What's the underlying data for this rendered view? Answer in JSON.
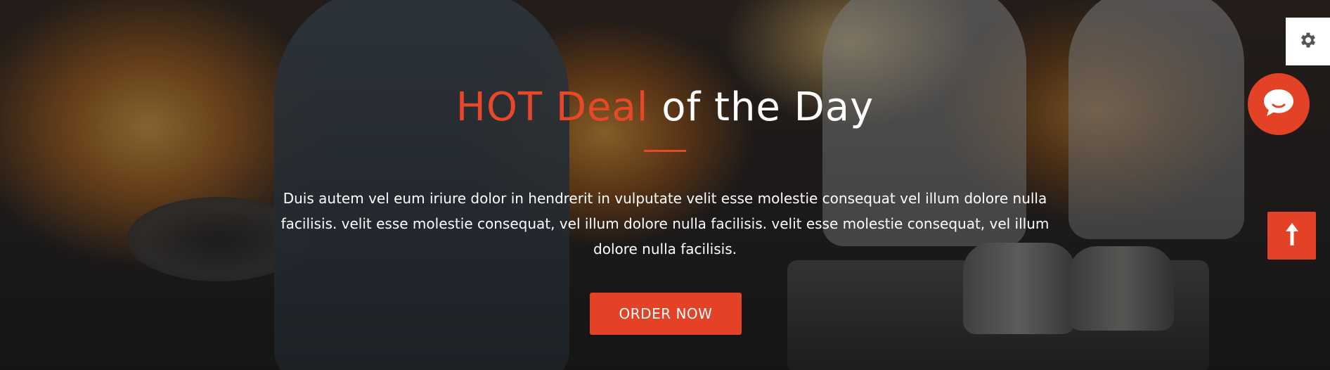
{
  "hero": {
    "title_accent": "HOT Deal",
    "title_rest": "of the Day",
    "description": "Duis autem vel eum iriure dolor in hendrerit in vulputate velit esse molestie consequat vel illum dolore nulla facilisis. velit esse molestie consequat, vel illum dolore nulla facilisis. velit esse molestie consequat, vel illum dolore nulla facilisis.",
    "button_label": "ORDER NOW"
  },
  "widgets": {
    "settings_icon": "gear-icon",
    "chat_icon": "chat-bubble-icon",
    "back_to_top_icon": "arrow-up-icon"
  },
  "colors": {
    "accent": "#e44226",
    "text_light": "#ffffff"
  }
}
